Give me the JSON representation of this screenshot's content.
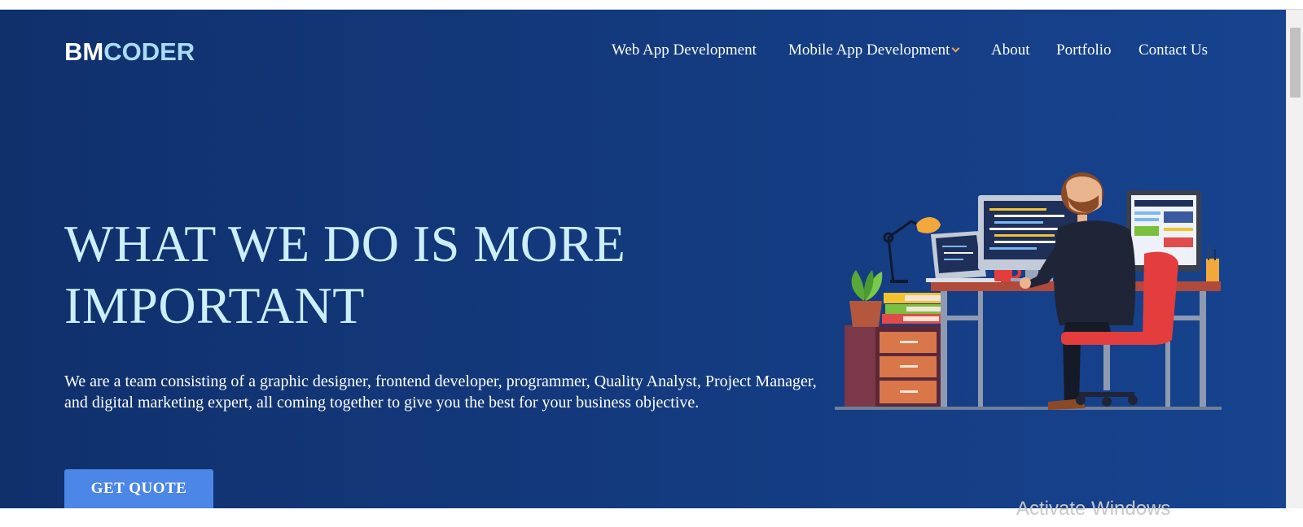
{
  "logo": {
    "part1": "BM",
    "part2": "CODER"
  },
  "nav": {
    "items": [
      {
        "label": "Web App Development"
      },
      {
        "label": "Mobile App Development",
        "has_dropdown": true
      },
      {
        "label": "About"
      },
      {
        "label": "Portfolio"
      },
      {
        "label": "Contact Us"
      }
    ]
  },
  "hero": {
    "headline_line1": "WHAT WE DO IS MORE",
    "headline_line2": "IMPORTANT",
    "description": "We are a team consisting of a graphic designer, frontend developer, programmer, Quality Analyst, Project Manager, and digital marketing expert, all coming together to give you the best for your business objective.",
    "cta_label": "GET QUOTE",
    "illustration": "developer-at-desk-illustration"
  },
  "os": {
    "watermark": "Activate Windows"
  },
  "colors": {
    "hero_bg": "#143b80",
    "logo_accent": "#a9dcf5",
    "headline": "#cdeefc",
    "cta_bg": "#4c86e6",
    "dropdown_caret": "#f2a35a"
  }
}
